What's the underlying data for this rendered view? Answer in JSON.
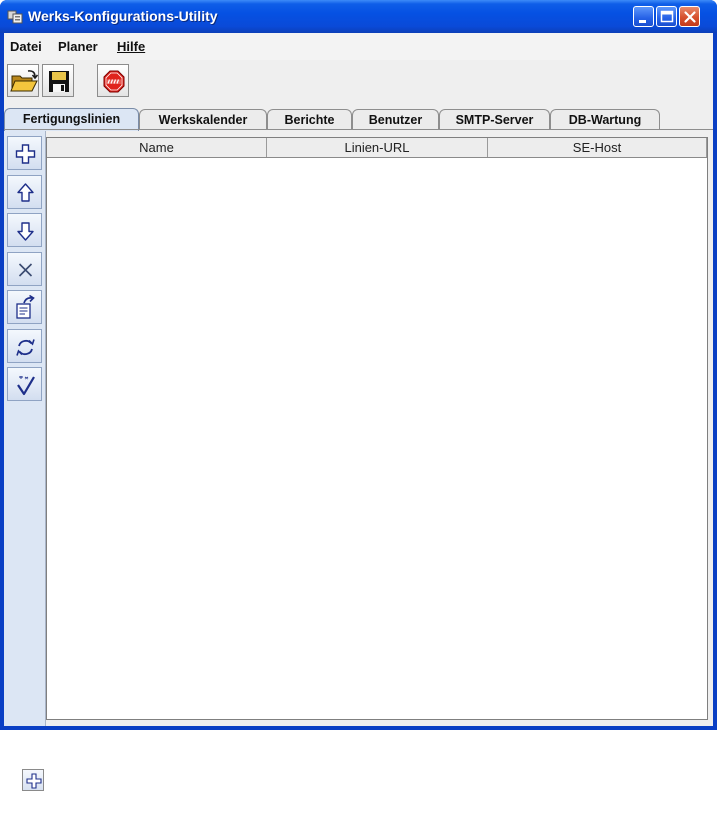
{
  "window": {
    "title": "Werks-Konfigurations-Utility",
    "icon": "app-icon",
    "controls": [
      "minimize-icon",
      "maximize-icon",
      "close-icon"
    ]
  },
  "menu": {
    "items": [
      {
        "label": "Datei"
      },
      {
        "label": "Planer"
      },
      {
        "label": "Hilfe"
      }
    ]
  },
  "toolbar": {
    "buttons": [
      {
        "icon": "open-folder-icon"
      },
      {
        "icon": "save-disk-icon"
      },
      {
        "icon": "stop-sign-icon"
      }
    ]
  },
  "tabs": {
    "items": [
      {
        "label": "Fertigungslinien",
        "active": true
      },
      {
        "label": "Werkskalender"
      },
      {
        "label": "Berichte"
      },
      {
        "label": "Benutzer"
      },
      {
        "label": "SMTP-Server"
      },
      {
        "label": "DB-Wartung"
      }
    ]
  },
  "sidebar": {
    "buttons": [
      {
        "icon": "add-plus-icon"
      },
      {
        "icon": "move-up-arrow-icon"
      },
      {
        "icon": "move-down-arrow-icon"
      },
      {
        "icon": "delete-x-icon"
      },
      {
        "icon": "edit-document-icon"
      },
      {
        "icon": "refresh-cycle-icon"
      },
      {
        "icon": "validate-check-icon"
      }
    ]
  },
  "table": {
    "columns": [
      "Name",
      "Linien-URL",
      "SE-Host"
    ],
    "rows": []
  },
  "floating_button": {
    "icon": "add-plus-icon"
  },
  "colors": {
    "titlebar": "#0551e3",
    "tab_active": "#dce6f4",
    "window_background": "#efefef"
  }
}
